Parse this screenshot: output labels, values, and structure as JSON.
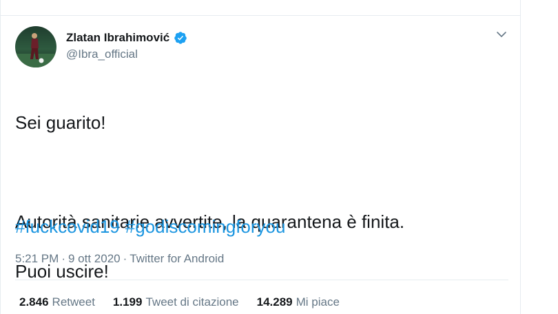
{
  "user": {
    "display_name": "Zlatan Ibrahimović",
    "handle": "@Ibra_official",
    "verified_icon": "verified-badge-icon"
  },
  "tweet": {
    "line1": "Sei guarito!",
    "line2": "Autorità sanitarie avvertite, la quarantena è finita.",
    "line3": "Puoi uscire!",
    "hashtags": [
      "#fuckcovid19",
      "#godiscomingforyou"
    ]
  },
  "meta": {
    "time": "5:21 PM",
    "separator1": "·",
    "date": "9 ott 2020",
    "separator2": "·",
    "source": "Twitter for Android"
  },
  "stats": [
    {
      "num": "2.846",
      "label": "Retweet"
    },
    {
      "num": "1.199",
      "label": "Tweet di citazione"
    },
    {
      "num": "14.289",
      "label": "Mi piace"
    }
  ],
  "colors": {
    "link": "#1b95e0",
    "verified": "#1da1f2",
    "muted": "#657786"
  }
}
